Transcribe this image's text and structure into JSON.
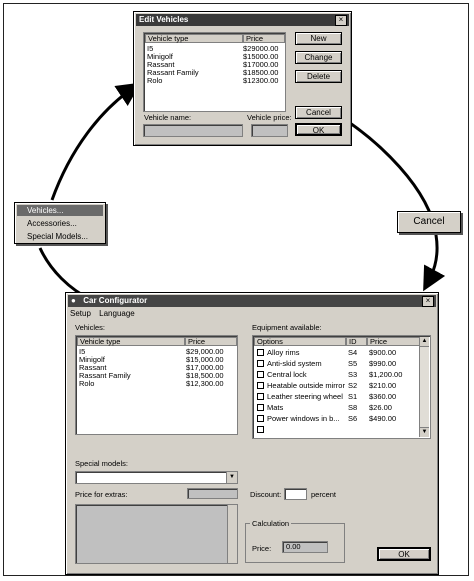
{
  "edit_window": {
    "title": "Edit Vehicles",
    "columns": [
      "Vehicle type",
      "Price"
    ],
    "rows": [
      {
        "type": "I5",
        "price": "$29000.00"
      },
      {
        "type": "Minigolf",
        "price": "$15000.00"
      },
      {
        "type": "Rassant",
        "price": "$17000.00"
      },
      {
        "type": "Rassant Family",
        "price": "$18500.00"
      },
      {
        "type": "Rolo",
        "price": "$12300.00"
      }
    ],
    "buttons": {
      "new": "New",
      "change": "Change",
      "delete": "Delete",
      "cancel": "Cancel",
      "ok": "OK"
    },
    "vehicle_name_label": "Vehicle name:",
    "vehicle_price_label": "Vehicle price:"
  },
  "popup_menu": {
    "items": [
      "Vehicles...",
      "Accessories...",
      "Special Models..."
    ]
  },
  "cancel_callout": "Cancel",
  "configurator": {
    "title": "Car Configurator",
    "title_visible": "Car Configurator",
    "menu": [
      "Setup",
      "Language"
    ],
    "vehicles_label": "Vehicles:",
    "vehicle_columns": [
      "Vehicle type",
      "Price"
    ],
    "vehicles": [
      {
        "type": "I5",
        "price": "$29,000.00"
      },
      {
        "type": "Minigolf",
        "price": "$15,000.00"
      },
      {
        "type": "Rassant",
        "price": "$17,000.00"
      },
      {
        "type": "Rassant Family",
        "price": "$18,500.00"
      },
      {
        "type": "Rolo",
        "price": "$12,300.00"
      }
    ],
    "equipment_label": "Equipment available:",
    "equipment_columns": [
      "Options",
      "ID",
      "Price"
    ],
    "equipment": [
      {
        "option": "Alloy rims",
        "id": "S4",
        "price": "$900.00"
      },
      {
        "option": "Anti-skid system",
        "id": "S5",
        "price": "$990.00"
      },
      {
        "option": "Central lock",
        "id": "S3",
        "price": "$1,200.00"
      },
      {
        "option": "Heatable outside mirror",
        "id": "S2",
        "price": "$210.00"
      },
      {
        "option": "Leather steering wheel",
        "id": "S1",
        "price": "$360.00"
      },
      {
        "option": "Mats",
        "id": "S8",
        "price": "$26.00"
      },
      {
        "option": "Power windows in b...",
        "id": "S6",
        "price": "$490.00"
      }
    ],
    "special_models_label": "Special models:",
    "price_extras_label": "Price for extras:",
    "discount_label": "Discount:",
    "percent_label": "percent",
    "calculation_label": "Calculation",
    "price_label": "Price:",
    "price_value": "0.00",
    "ok_label": "OK"
  }
}
